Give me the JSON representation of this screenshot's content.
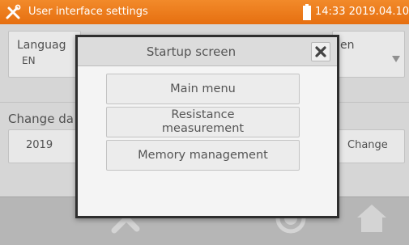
{
  "header": {
    "title": "User interface settings",
    "time": "14:33 2019.04.10",
    "icons": [
      "tools-icon",
      "battery-icon"
    ],
    "colors": {
      "bar": "#ec7b1c"
    }
  },
  "background": {
    "language_label": "Languag",
    "language_value": "EN",
    "startup_label_fragment": "en",
    "date_label": "Change da",
    "date_value_fragment": "2019",
    "change_button": "Change"
  },
  "bottom_bar": {
    "icons": [
      "tools-icon",
      "help-icon",
      "home-icon"
    ]
  },
  "dialog": {
    "title": "Startup screen",
    "close_icon": "close-icon",
    "options": [
      {
        "label": "Main menu"
      },
      {
        "label": "Resistance measurement"
      },
      {
        "label": "Memory management"
      }
    ]
  }
}
